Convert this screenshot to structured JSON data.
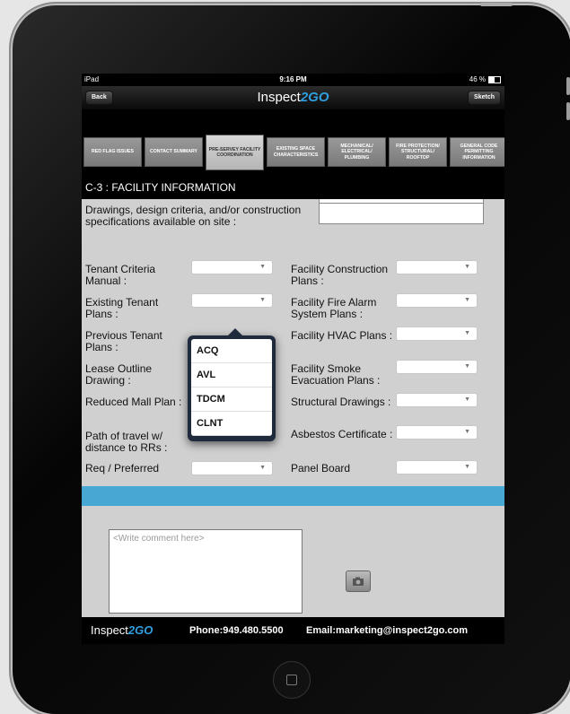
{
  "status_bar": {
    "device": "iPad",
    "time": "9:16 PM",
    "battery": "46 %",
    "battery_level": 0.46
  },
  "nav": {
    "back_label": "Back",
    "brand_prefix": "Inspect",
    "brand_accent": "2GO",
    "sketch_label": "Sketch"
  },
  "tabs": [
    {
      "label": "RED FLAG ISSUES"
    },
    {
      "label": "CONTACT SUMMARY"
    },
    {
      "label": "PRE-SERVEY FACILITY COORDINATION",
      "active": true
    },
    {
      "label": "EXISTING SPACE CHARACTERISTICS"
    },
    {
      "label": "MECHANICAL/ ELECTRICAL/ PLUMBING"
    },
    {
      "label": "FIRE PROTECTION/ STRUCTURAL/ ROOFTOP"
    },
    {
      "label": "GENERAL CODE PERMITTING INFORMATION"
    }
  ],
  "section_title": "C-3 : FACILITY INFORMATION",
  "form": {
    "drawings_label": "Drawings, design criteria, and/or construction specifications available on site :",
    "left_fields": [
      "Tenant Criteria Manual :",
      "Existing Tenant Plans :",
      "Previous Tenant Plans :",
      "Lease Outline Drawing :",
      "Reduced Mall Plan :",
      "Path of travel w/ distance to RRs :",
      "Req / Preferred"
    ],
    "right_fields": [
      "Facility Construction Plans :",
      "Facility Fire Alarm System Plans :",
      "Facility HVAC Plans :",
      "Facility Smoke Evacuation Plans :",
      "Structural Drawings :",
      "Asbestos Certificate :",
      "Panel Board"
    ]
  },
  "dropdown": {
    "options": [
      "ACQ",
      "AVL",
      "TDCM",
      "CLNT"
    ]
  },
  "comment": {
    "placeholder": "<Write comment here>"
  },
  "footer": {
    "brand_prefix": "Inspect",
    "brand_accent": "2GO",
    "phone": "Phone:949.480.5500",
    "email": "Email:marketing@inspect2go.com"
  },
  "colors": {
    "accent": "#48a8d3",
    "brand_blue": "#2f9fe0",
    "form_bg": "#d0d0d0"
  }
}
